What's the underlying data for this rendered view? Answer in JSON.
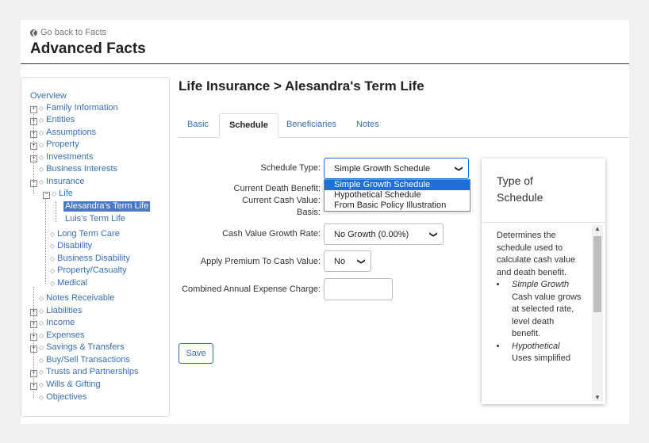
{
  "header": {
    "back_label": "Go back to Facts",
    "title": "Advanced Facts"
  },
  "tree": {
    "overview": "Overview",
    "family": "Family Information",
    "entities": "Entities",
    "assumptions": "Assumptions",
    "property": "Property",
    "investments": "Investments",
    "business_interests": "Business Interests",
    "insurance": "Insurance",
    "life": "Life",
    "alesandra": "Alesandra's Term Life",
    "luis": "Luis's Term Life",
    "ltc": "Long Term Care",
    "disability": "Disability",
    "business_disability": "Business Disability",
    "pc": "Property/Casualty",
    "medical": "Medical",
    "notes_receivable": "Notes Receivable",
    "liabilities": "Liabilities",
    "income": "Income",
    "expenses": "Expenses",
    "savings": "Savings & Transfers",
    "buysell": "Buy/Sell Transactions",
    "trusts": "Trusts and Partnerships",
    "wills": "Wills & Gifting",
    "objectives": "Objectives"
  },
  "main": {
    "heading": "Life Insurance > Alesandra's Term Life",
    "tabs": [
      "Basic",
      "Schedule",
      "Beneficiaries",
      "Notes"
    ],
    "form": {
      "schedule_type_label": "Schedule Type:",
      "schedule_type_value": "Simple Growth Schedule",
      "schedule_options": [
        "Simple Growth Schedule",
        "Hypothetical Schedule",
        "From Basic Policy Illustration"
      ],
      "death_benefit_label": "Current Death Benefit:",
      "cash_value_label": "Current Cash Value:",
      "basis_label": "Basis:",
      "growth_rate_label": "Cash Value Growth Rate:",
      "growth_rate_value": "No Growth (0.00%)",
      "apply_premium_label": "Apply Premium To Cash Value:",
      "apply_premium_value": "No",
      "expense_charge_label": "Combined Annual Expense Charge:",
      "expense_charge_value": "",
      "save_label": "Save"
    }
  },
  "help": {
    "title": "Type of Schedule",
    "intro": "Determines the schedule used to calculate cash value and death benefit.",
    "items": [
      {
        "term": "Simple Growth",
        "desc": "Cash value grows at selected rate, level death benefit."
      },
      {
        "term": "Hypothetical",
        "desc": "Uses simplified"
      }
    ]
  }
}
